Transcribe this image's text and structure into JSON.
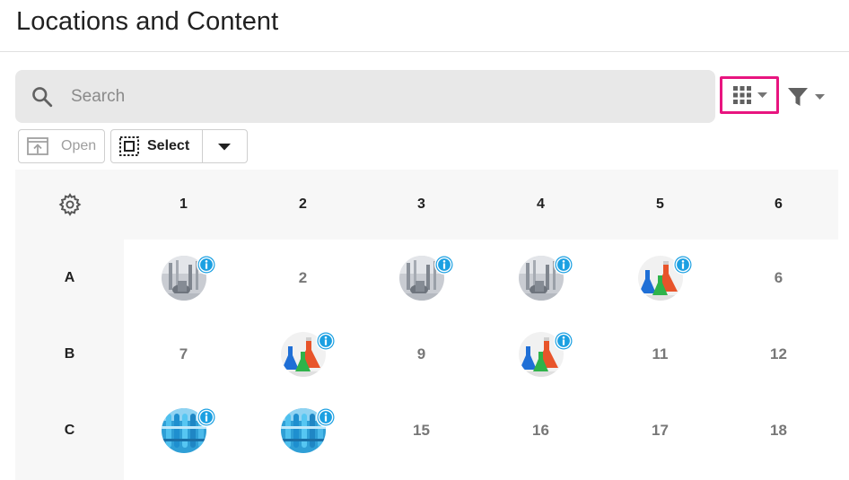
{
  "header": {
    "title": "Locations and Content"
  },
  "search": {
    "placeholder": "Search"
  },
  "toolbar": {
    "open_label": "Open",
    "select_label": "Select"
  },
  "colors": {
    "highlight": "#e8157f",
    "info_blue": "#1ba0e2"
  },
  "grid": {
    "columns": [
      "1",
      "2",
      "3",
      "4",
      "5",
      "6"
    ],
    "rows": [
      {
        "label": "A",
        "cells": [
          {
            "type": "image",
            "image": "glassware-gray"
          },
          {
            "type": "number",
            "value": "2"
          },
          {
            "type": "image",
            "image": "glassware-gray"
          },
          {
            "type": "image",
            "image": "glassware-gray"
          },
          {
            "type": "image",
            "image": "flasks-colored"
          },
          {
            "type": "number",
            "value": "6"
          }
        ]
      },
      {
        "label": "B",
        "cells": [
          {
            "type": "number",
            "value": "7"
          },
          {
            "type": "image",
            "image": "flasks-colored"
          },
          {
            "type": "number",
            "value": "9"
          },
          {
            "type": "image",
            "image": "flasks-colored"
          },
          {
            "type": "number",
            "value": "11"
          },
          {
            "type": "number",
            "value": "12"
          }
        ]
      },
      {
        "label": "C",
        "cells": [
          {
            "type": "image",
            "image": "test-tubes-blue"
          },
          {
            "type": "image",
            "image": "test-tubes-blue"
          },
          {
            "type": "number",
            "value": "15"
          },
          {
            "type": "number",
            "value": "16"
          },
          {
            "type": "number",
            "value": "17"
          },
          {
            "type": "number",
            "value": "18"
          }
        ]
      }
    ]
  }
}
